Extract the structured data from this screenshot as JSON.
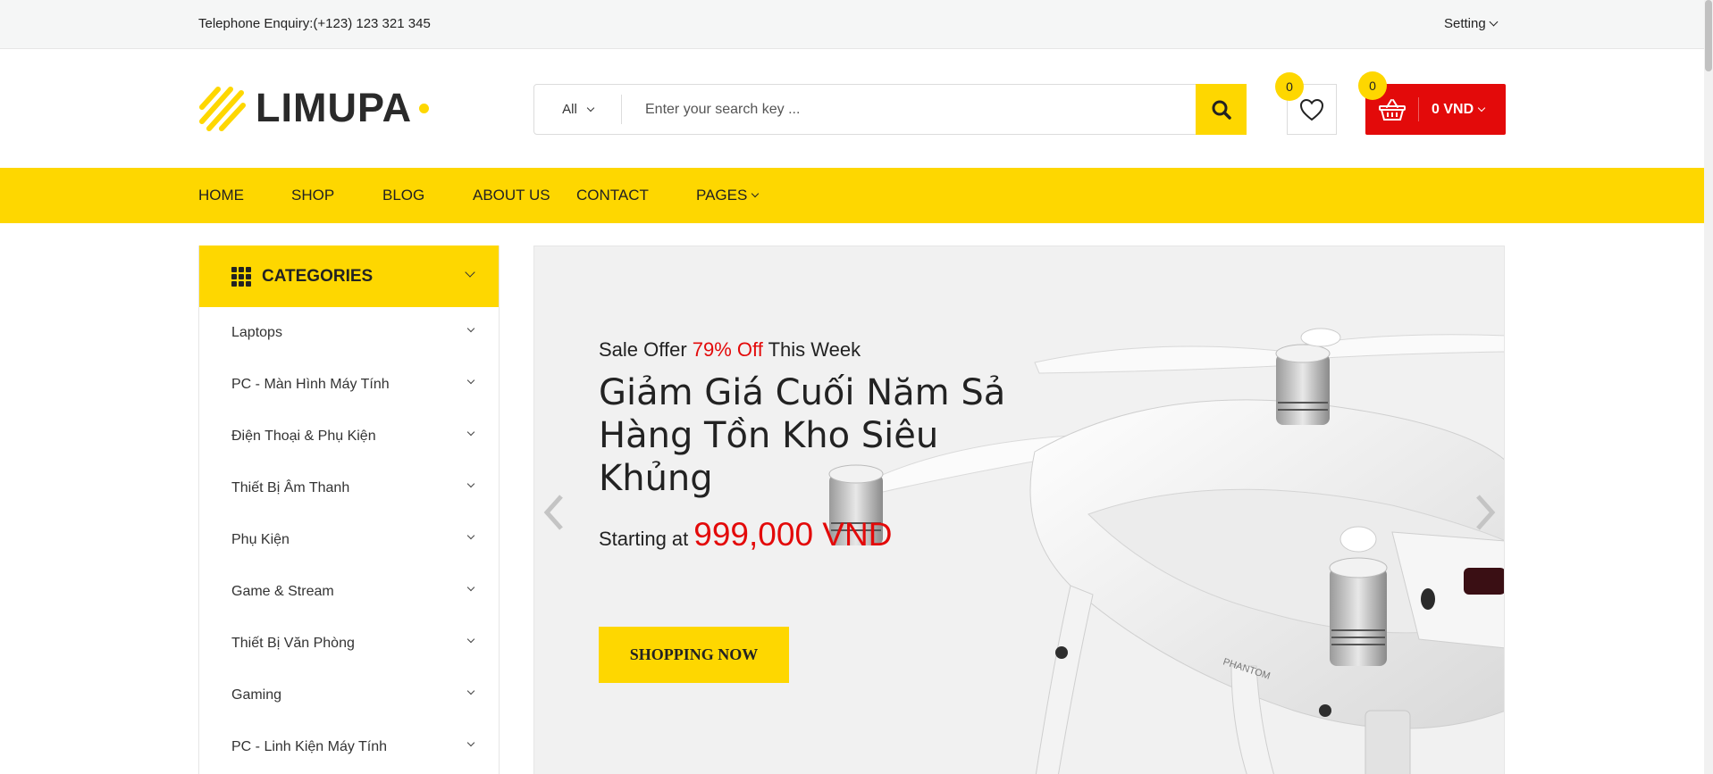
{
  "topbar": {
    "phone": "Telephone Enquiry:(+123) 123 321 345",
    "setting_label": "Setting"
  },
  "header": {
    "logo_text": "LIMUPA",
    "search": {
      "category": "All",
      "placeholder": "Enter your search key ..."
    },
    "wishlist_count": "0",
    "cart_count": "0",
    "cart_total": "0 VND"
  },
  "nav": {
    "items": [
      "HOME",
      "SHOP",
      "BLOG",
      "ABOUT US",
      "CONTACT",
      "PAGES"
    ]
  },
  "categories": {
    "title": "CATEGORIES",
    "items": [
      "Laptops",
      "PC - Màn Hình Máy Tính",
      "Điện Thoại & Phụ Kiện",
      "Thiết Bị Âm Thanh",
      "Phụ Kiện",
      "Game & Stream",
      "Thiết Bị Văn Phòng",
      "Gaming",
      "PC - Linh Kiện Máy Tính"
    ]
  },
  "hero": {
    "offer_prefix": "Sale Offer ",
    "offer_highlight": "79% Off",
    "offer_suffix": " This Week",
    "headline": "Giảm Giá Cuối Năm Sả Hàng Tồn Kho Siêu Khủng",
    "price_label": "Starting at",
    "price_value": "999,000 VND",
    "button_label": "SHOPPING NOW",
    "product_label": "PHANTOM"
  },
  "colors": {
    "brand_yellow": "#fed700",
    "accent_red": "#e30a0a",
    "text_dark": "#222222"
  }
}
